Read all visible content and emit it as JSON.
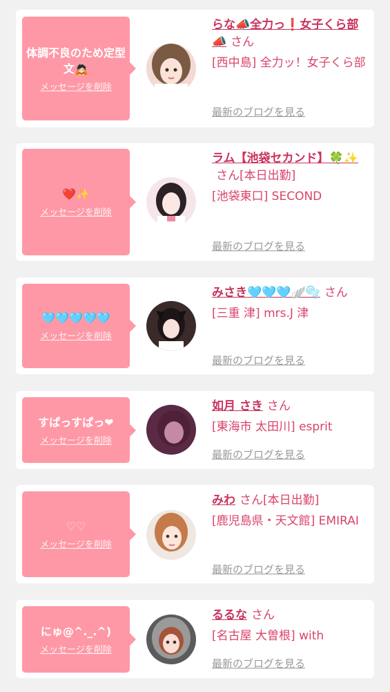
{
  "colors": {
    "background": "#f2f1f1",
    "card": "#ffffff",
    "bubble": "#ff98a6",
    "name": "#c8335c",
    "text_pink": "#d9436a",
    "blog_link": "#999999"
  },
  "delete_label": "メッセージを削除",
  "san_label": "さん",
  "blog_label": "最新のブログを見る",
  "entries": [
    {
      "message": "体調不良のため定型文🙇🏻",
      "name": "らな📣全力っ❗️女子くら部📣",
      "status": "",
      "shop": "[西中島] 全力ッ！女子くら部"
    },
    {
      "message": "❤️✨",
      "name": "ラム【池袋セカンド】🍀✨",
      "status": "[本日出勤]",
      "shop": "[池袋東口] SECOND"
    },
    {
      "message": "🩵🩵🩵🩵🩵",
      "name": "みさき🩵🩵🩵🪽🫧",
      "status": "",
      "shop": "[三重 津] mrs.J 津"
    },
    {
      "message": "すぱっすぱっ❤",
      "name": "如月 さき",
      "status": "",
      "shop": "[東海市 太田川] esprit"
    },
    {
      "message": "♡♡",
      "name": "みわ",
      "status": "[本日出勤]",
      "shop": "[鹿児島県・天文館] EMIRAI"
    },
    {
      "message": "にゅ@^._.^)",
      "name": "るるな",
      "status": "",
      "shop": "[名古屋 大曽根] with"
    }
  ]
}
